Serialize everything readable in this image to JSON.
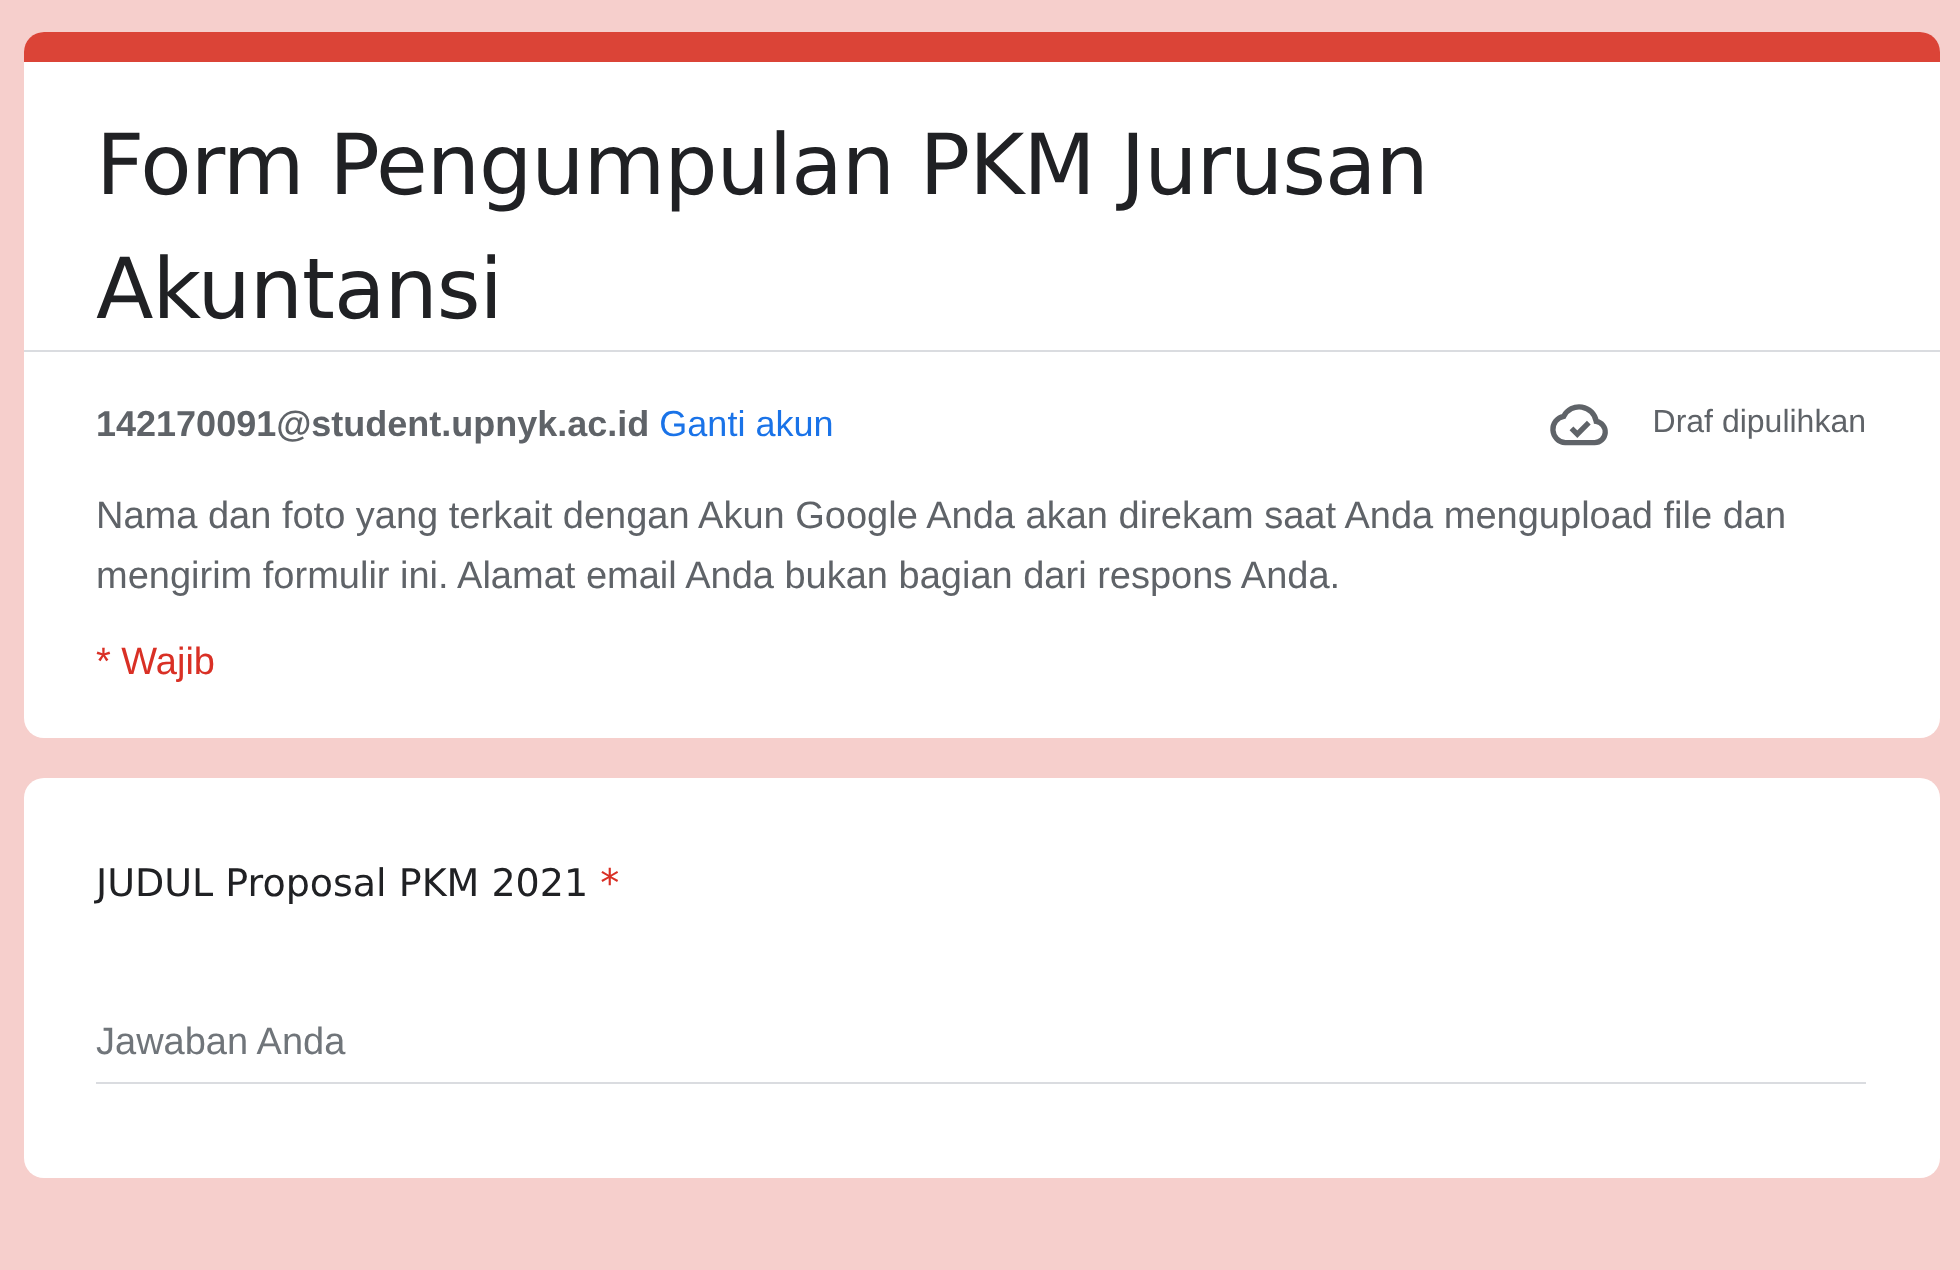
{
  "form": {
    "title": "Form Pengumpulan PKM Jurusan Akuntansi",
    "account": "142170091@student.upnyk.ac.id",
    "switch_account": "Ganti akun",
    "draft_status": "Draf dipulihkan",
    "notice": "Nama dan foto yang terkait dengan Akun Google Anda akan direkam saat Anda mengupload file dan mengirim formulir ini. Alamat email Anda bukan bagian dari respons Anda.",
    "required_note": "* Wajib"
  },
  "questions": [
    {
      "kind": "short_answer",
      "title": "JUDUL Proposal PKM 2021",
      "required": true,
      "required_mark": "*",
      "placeholder": "Jawaban Anda"
    }
  ]
}
